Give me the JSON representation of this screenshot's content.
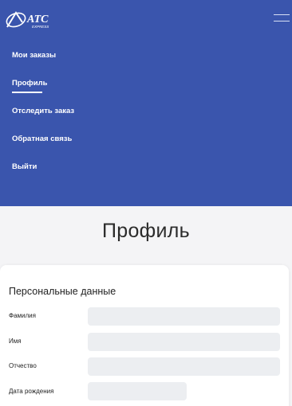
{
  "header": {
    "logo_text": "ATC",
    "logo_subtext": "EXPRESS"
  },
  "menu": {
    "items": [
      {
        "label": "Мои заказы",
        "active": false
      },
      {
        "label": "Профиль",
        "active": true
      },
      {
        "label": "Отследить заказ",
        "active": false
      },
      {
        "label": "Обратная связь",
        "active": false
      },
      {
        "label": "Выйти",
        "active": false
      }
    ]
  },
  "page": {
    "title": "Профиль"
  },
  "personal_data": {
    "title": "Персональные данные",
    "fields": [
      {
        "label": "Фамилия",
        "value": ""
      },
      {
        "label": "Имя",
        "value": ""
      },
      {
        "label": "Отчество",
        "value": ""
      },
      {
        "label": "Дата рождения",
        "value": ""
      }
    ]
  },
  "colors": {
    "nav_background": "#3a55ad",
    "page_background": "#f4f4f6",
    "input_background": "#eceef1"
  }
}
